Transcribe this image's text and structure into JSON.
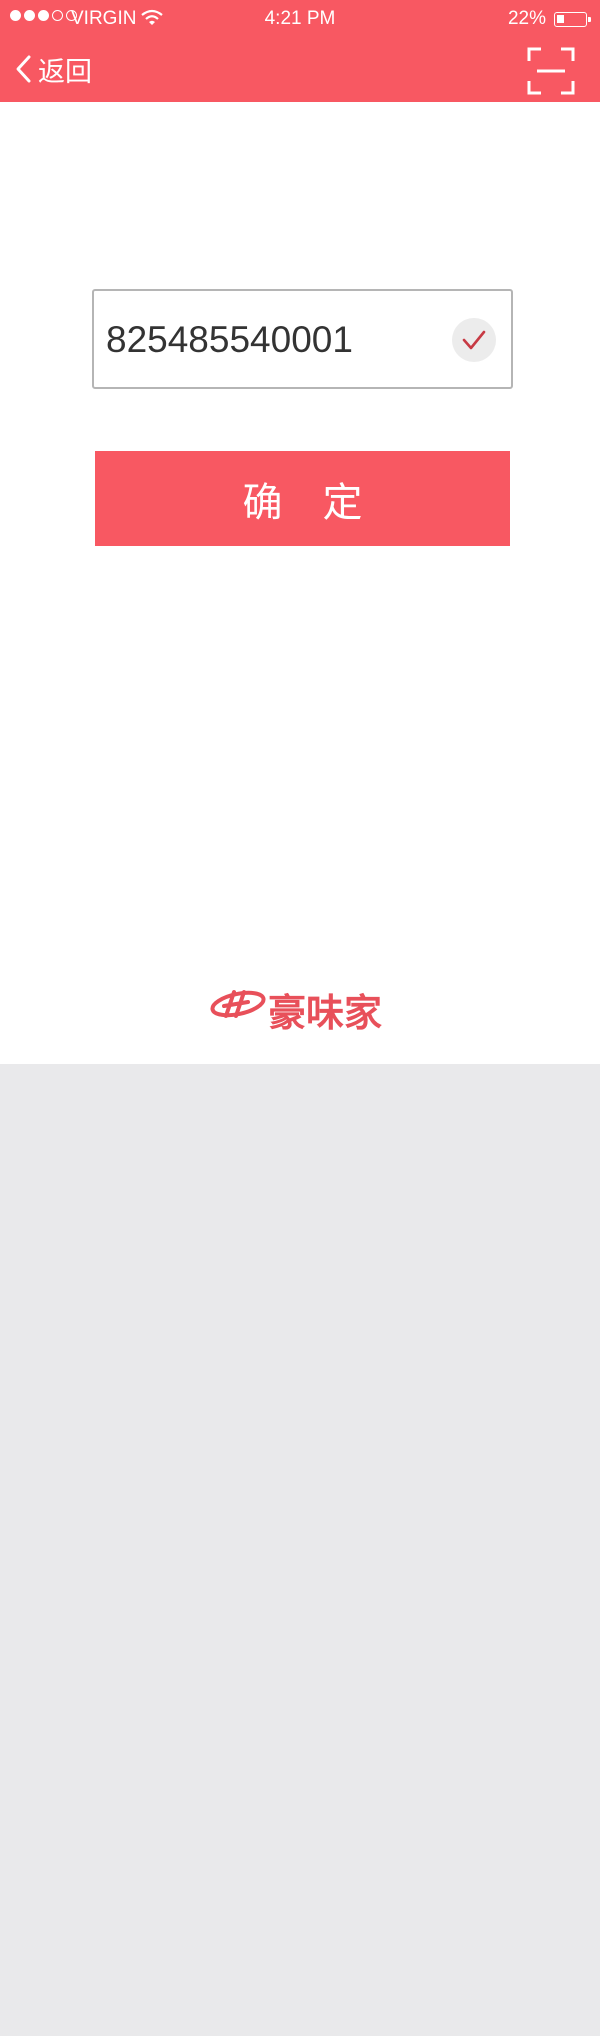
{
  "status_bar": {
    "carrier": "VIRGIN",
    "time": "4:21 PM",
    "battery_percent": "22%"
  },
  "nav": {
    "back_label": "返回"
  },
  "form": {
    "code_value": "825485540001"
  },
  "confirm_label": "确定",
  "brand": {
    "name": "豪味家"
  },
  "icons": [
    "chevron-left-icon",
    "scan-icon",
    "check-icon",
    "wifi-icon",
    "battery-icon",
    "signal-icon"
  ],
  "colors": {
    "accent": "#f85862",
    "page_bg": "#e9e9eb",
    "content_bg": "#ffffff",
    "check_mark": "#c73a44"
  }
}
